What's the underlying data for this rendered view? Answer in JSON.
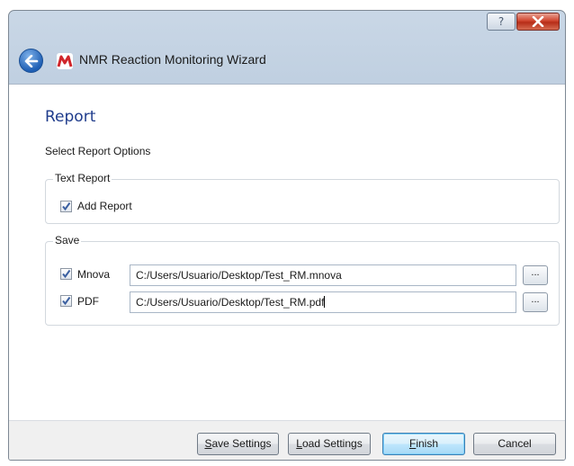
{
  "window": {
    "help_label": "?",
    "wizard_title": "NMR Reaction Monitoring Wizard"
  },
  "page": {
    "heading": "Report",
    "subheading": "Select Report Options"
  },
  "text_report": {
    "group_label": "Text Report",
    "add_report": {
      "label": "Add Report",
      "checked": true
    }
  },
  "save": {
    "group_label": "Save",
    "mnova": {
      "label": "Mnova",
      "checked": true,
      "path": "C:/Users/Usuario/Desktop/Test_RM.mnova",
      "browse_label": "..."
    },
    "pdf": {
      "label": "PDF",
      "checked": true,
      "path": "C:/Users/Usuario/Desktop/Test_RM.pdf",
      "browse_label": "..."
    }
  },
  "footer": {
    "save_settings": {
      "mnemonic": "S",
      "rest": "ave Settings"
    },
    "load_settings": {
      "mnemonic": "L",
      "rest": "oad Settings"
    },
    "finish": {
      "mnemonic": "F",
      "rest": "inish"
    },
    "cancel": "Cancel"
  },
  "colors": {
    "heading": "#1f3c8c",
    "close_button": "#c63a22",
    "default_button_border": "#3c7fb1"
  },
  "icons": [
    "help-icon",
    "close-icon",
    "back-arrow-icon",
    "mnova-logo-icon",
    "checkmark-icon"
  ]
}
